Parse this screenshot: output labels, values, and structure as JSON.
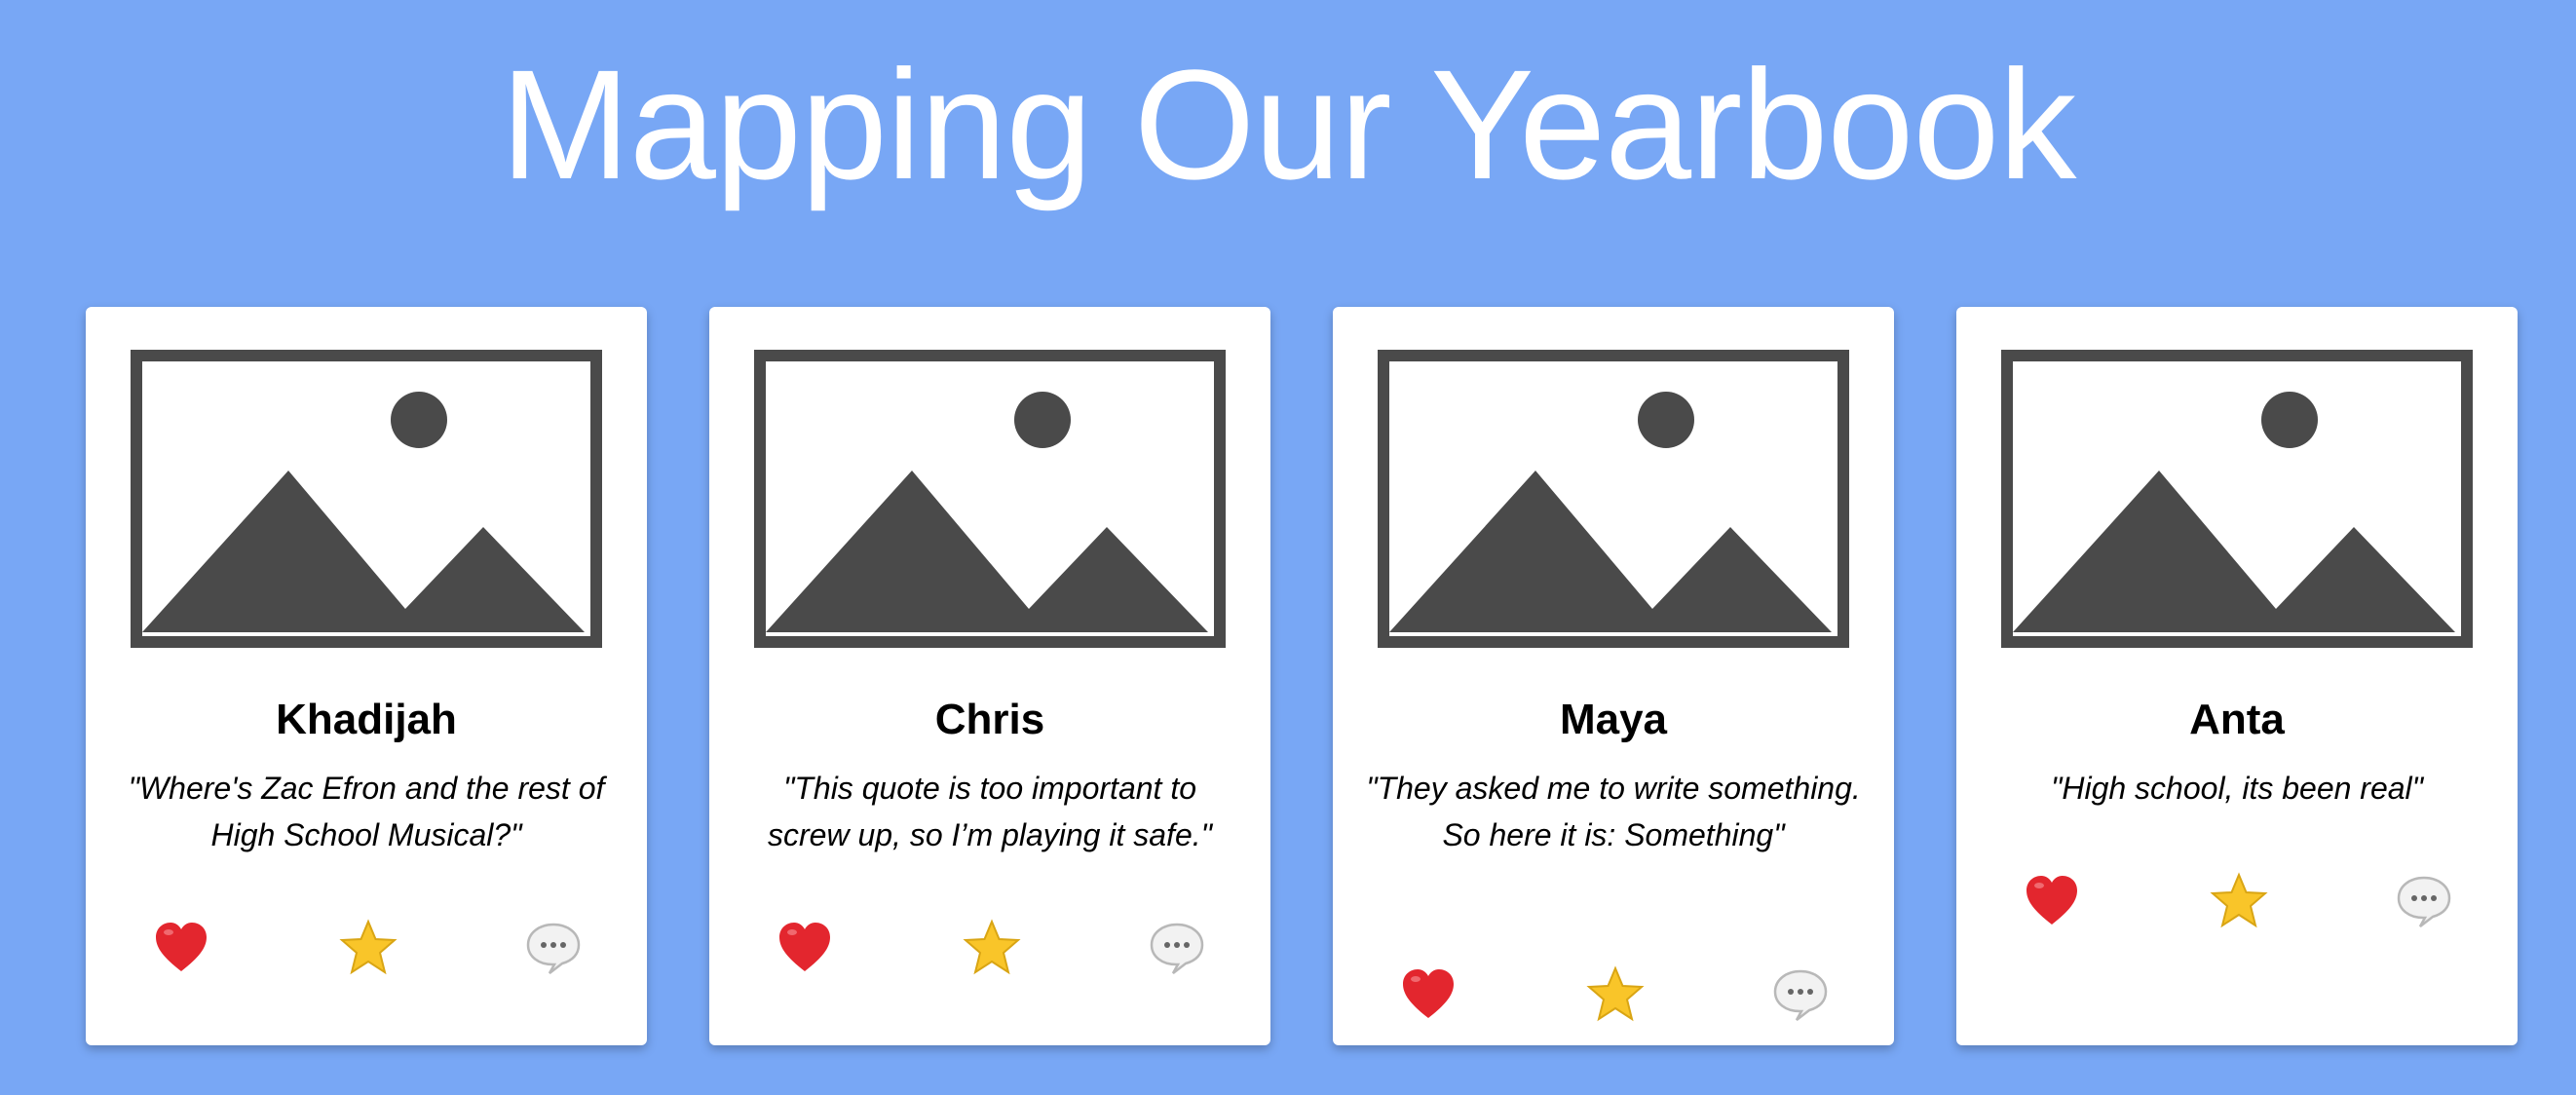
{
  "page": {
    "title": "Mapping Our Yearbook",
    "background_color": "#78a7f5"
  },
  "cards": [
    {
      "name": "Khadijah",
      "quote": "\"Where's Zac Efron and the rest of High School Musical?\"",
      "photo_icon": "image-placeholder-icon",
      "actions": {
        "like_icon": "heart-icon",
        "favorite_icon": "star-icon",
        "comment_icon": "speech-bubble-icon"
      }
    },
    {
      "name": "Chris",
      "quote": "\"This quote is too important to screw up, so I’m playing it safe.\"",
      "photo_icon": "image-placeholder-icon",
      "actions": {
        "like_icon": "heart-icon",
        "favorite_icon": "star-icon",
        "comment_icon": "speech-bubble-icon"
      }
    },
    {
      "name": "Maya",
      "quote": "\"They asked me to write something. So here it is: Something\"",
      "photo_icon": "image-placeholder-icon",
      "actions": {
        "like_icon": "heart-icon",
        "favorite_icon": "star-icon",
        "comment_icon": "speech-bubble-icon"
      }
    },
    {
      "name": "Anta",
      "quote": "\"High school, its been real\"",
      "photo_icon": "image-placeholder-icon",
      "actions": {
        "like_icon": "heart-icon",
        "favorite_icon": "star-icon",
        "comment_icon": "speech-bubble-icon"
      }
    }
  ],
  "colors": {
    "card_background": "#ffffff",
    "placeholder_gray": "#4a4a4a",
    "heart_red": "#e3262e",
    "star_yellow": "#f9c529"
  }
}
